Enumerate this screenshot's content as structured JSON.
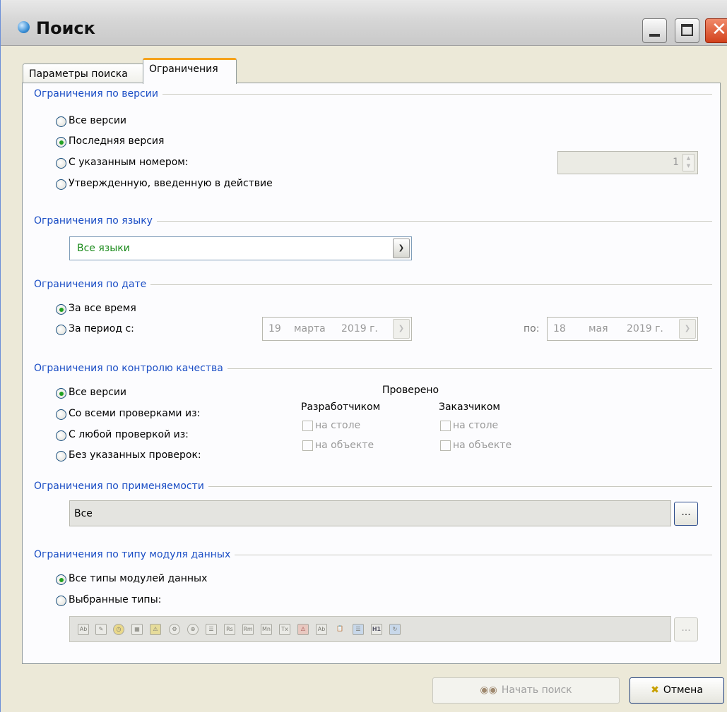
{
  "window": {
    "title": "Поиск"
  },
  "tabs": [
    {
      "label": "Параметры поиска"
    },
    {
      "label": "Ограничения"
    }
  ],
  "version": {
    "title": "Ограничения по версии",
    "options": [
      "Все версии",
      "Последняя версия",
      "С указанным номером:",
      "Утвержденную, введенную в действие"
    ],
    "selected": 1,
    "number": "1"
  },
  "language": {
    "title": "Ограничения по языку",
    "selected": "Все языки"
  },
  "date": {
    "title": "Ограничения по дате",
    "options": [
      "За все время",
      "За период с:"
    ],
    "selected": 0,
    "from": {
      "day": "19",
      "month": "марта",
      "year": "2019 г."
    },
    "to_label": "по:",
    "to": {
      "day": "18",
      "month": "мая",
      "year": "2019 г."
    }
  },
  "quality": {
    "title": "Ограничения по контролю качества",
    "options": [
      "Все версии",
      "Со всеми проверками из:",
      "С любой проверкой из:",
      "Без указанных проверок:"
    ],
    "selected": 0,
    "checked_title": "Проверено",
    "developer": "Разработчиком",
    "customer": "Заказчиком",
    "on_table": "на столе",
    "on_object": "на объекте"
  },
  "applicability": {
    "title": "Ограничения по применяемости",
    "value": "Все",
    "browse": "..."
  },
  "module_types": {
    "title": "Ограничения по типу модуля данных",
    "options": [
      "Все типы модулей данных",
      "Выбранные типы:"
    ],
    "selected": 0,
    "browse": "...",
    "icons": [
      "Ab",
      "pen",
      "clock",
      "table",
      "warn",
      "tool",
      "target",
      "list",
      "Rs",
      "Rm",
      "Mn",
      "Tx",
      "warn-red",
      "Ab",
      "clipboard",
      "tree",
      "H1",
      "refresh"
    ]
  },
  "buttons": {
    "search": "Начать поиск",
    "cancel": "Отмена"
  }
}
